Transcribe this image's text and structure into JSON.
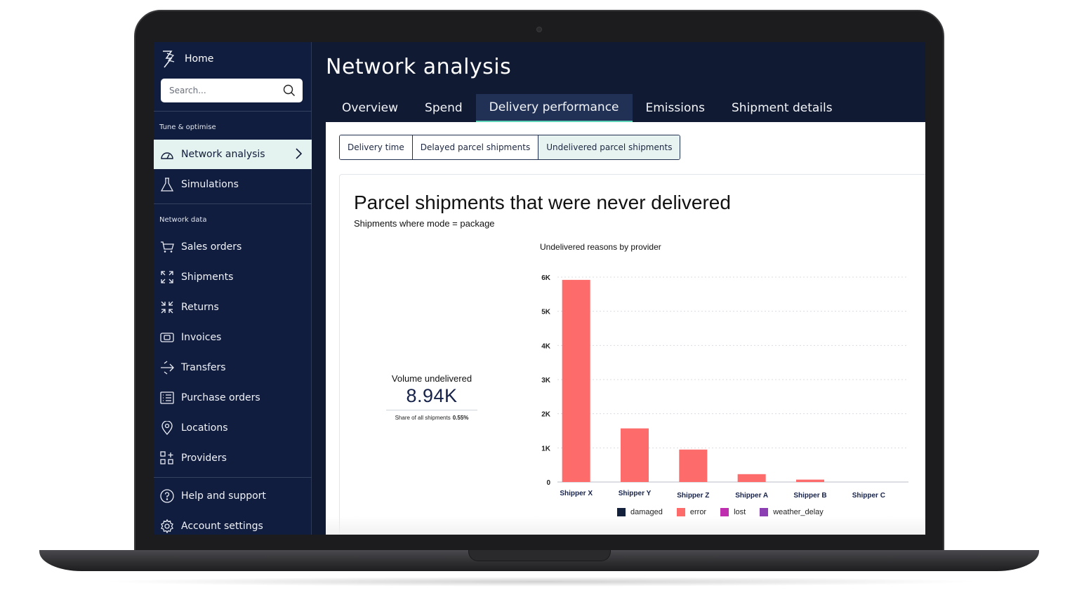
{
  "sidebar": {
    "home_label": "Home",
    "search_placeholder": "Search...",
    "section_tune": "Tune & optimise",
    "section_network_data": "Network data",
    "items": {
      "network_analysis": "Network analysis",
      "simulations": "Simulations",
      "sales_orders": "Sales orders",
      "shipments": "Shipments",
      "returns": "Returns",
      "invoices": "Invoices",
      "transfers": "Transfers",
      "purchase_orders": "Purchase orders",
      "locations": "Locations",
      "providers": "Providers",
      "help": "Help and support",
      "account": "Account settings"
    }
  },
  "header": {
    "title": "Network analysis",
    "tabs": [
      "Overview",
      "Spend",
      "Delivery performance",
      "Emissions",
      "Shipment details"
    ],
    "active_tab": "Delivery performance"
  },
  "subtabs": [
    "Delivery time",
    "Delayed parcel shipments",
    "Undelivered parcel shipments"
  ],
  "active_subtab": "Undelivered parcel shipments",
  "card": {
    "title": "Parcel shipments that were never delivered",
    "subtitle": "Shipments where mode = package"
  },
  "kpi": {
    "label": "Volume undelivered",
    "value": "8.94K",
    "share_label": "Share of all shipments",
    "share_value": "0.55%"
  },
  "colors": {
    "damaged": "#14213d",
    "error": "#fd6b6b",
    "lost": "#c02eb0",
    "weather_delay": "#8b3fb3"
  },
  "chart_data": {
    "type": "bar",
    "title": "Undelivered reasons by provider",
    "categories": [
      "Shipper X",
      "Shipper Y",
      "Shipper Z",
      "Shipper A",
      "Shipper B",
      "Shipper C"
    ],
    "series": [
      {
        "name": "damaged",
        "values": [
          0,
          0,
          0,
          0,
          0,
          0
        ]
      },
      {
        "name": "error",
        "values": [
          5920,
          1570,
          950,
          230,
          70,
          0
        ]
      },
      {
        "name": "lost",
        "values": [
          0,
          0,
          0,
          0,
          0,
          0
        ]
      },
      {
        "name": "weather_delay",
        "values": [
          0,
          0,
          0,
          0,
          0,
          0
        ]
      }
    ],
    "yticks": [
      "0",
      "1K",
      "2K",
      "3K",
      "4K",
      "5K",
      "6K"
    ],
    "ylim": [
      0,
      6000
    ],
    "grid": true,
    "legend": "bottom"
  }
}
